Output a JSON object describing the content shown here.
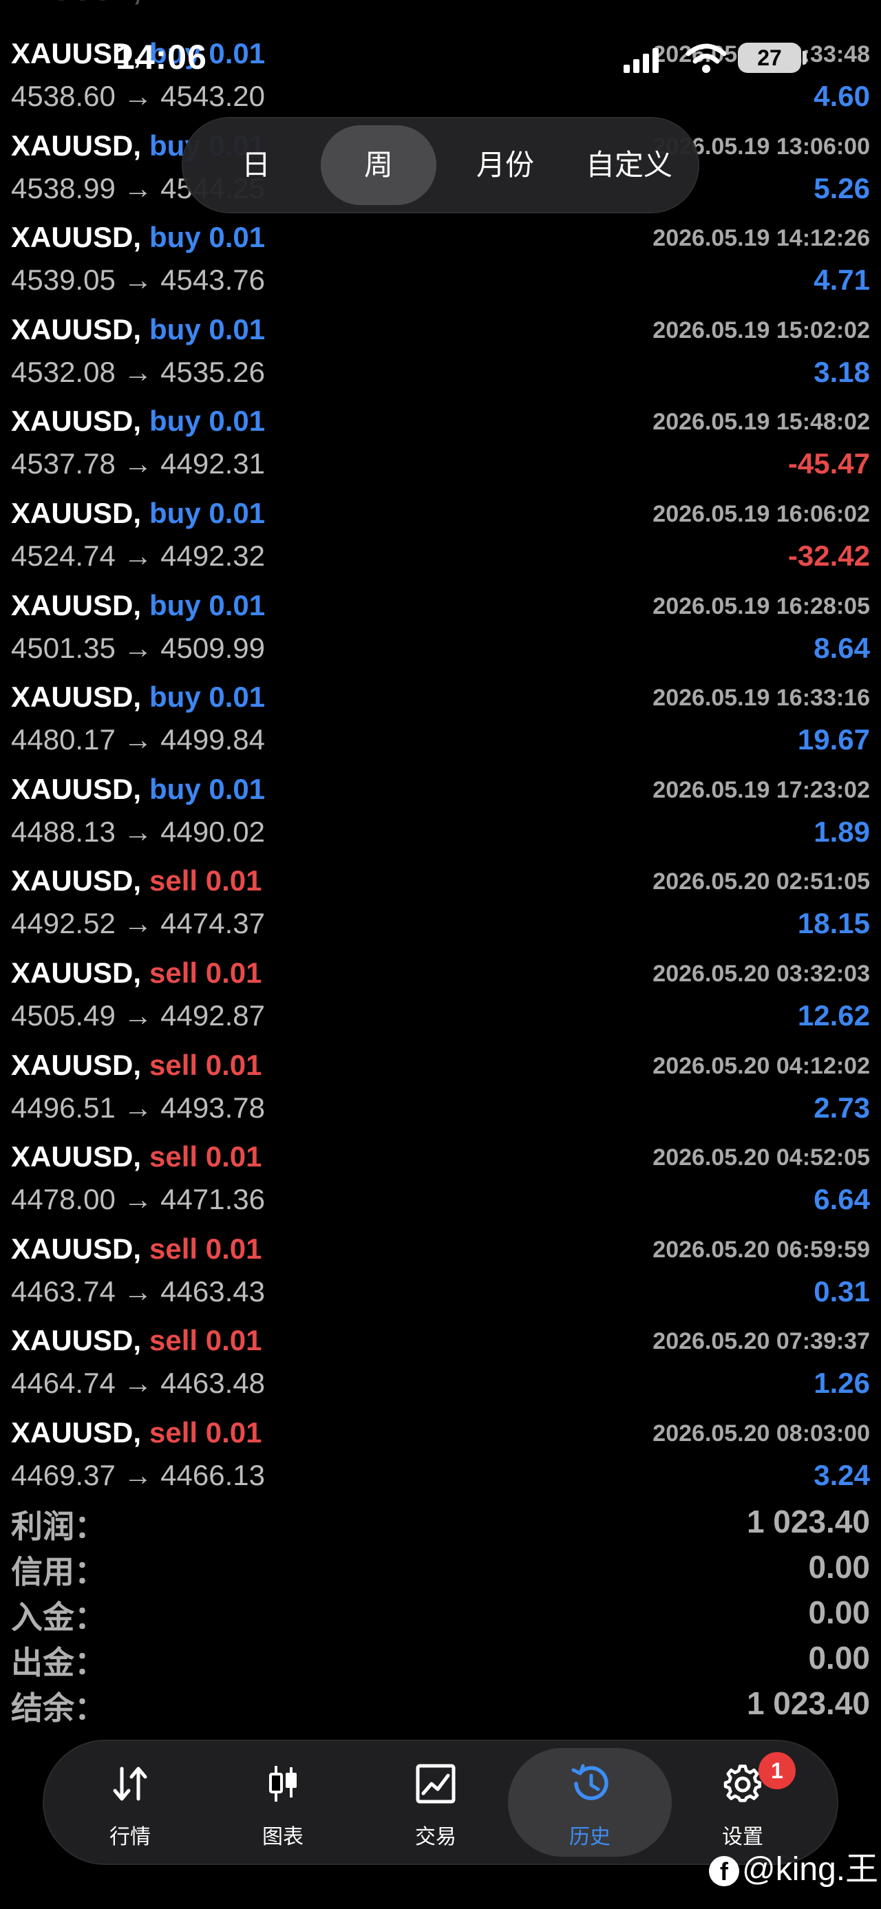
{
  "status_bar": {
    "time": "14:06",
    "battery": "27"
  },
  "period_tabs": [
    {
      "label": "日",
      "active": false
    },
    {
      "label": "周",
      "active": true
    },
    {
      "label": "月份",
      "active": false
    },
    {
      "label": "自定义",
      "active": false
    }
  ],
  "trades": [
    {
      "symbol": "XAUUSD,",
      "side": "buy",
      "lot": "buy 0.01",
      "time": "2026.05.19 12:33:48",
      "prices": "4538.60 → 4543.20",
      "profit": "4.60"
    },
    {
      "symbol": "XAUUSD,",
      "side": "buy",
      "lot": "buy 0.01",
      "time": "2026.05.19 13:06:00",
      "prices": "4538.99 → 4544.25",
      "profit": "5.26"
    },
    {
      "symbol": "XAUUSD,",
      "side": "buy",
      "lot": "buy 0.01",
      "time": "2026.05.19 14:12:26",
      "prices": "4539.05 → 4543.76",
      "profit": "4.71"
    },
    {
      "symbol": "XAUUSD,",
      "side": "buy",
      "lot": "buy 0.01",
      "time": "2026.05.19 15:02:02",
      "prices": "4532.08 → 4535.26",
      "profit": "3.18"
    },
    {
      "symbol": "XAUUSD,",
      "side": "buy",
      "lot": "buy 0.01",
      "time": "2026.05.19 15:48:02",
      "prices": "4537.78 → 4492.31",
      "profit": "-45.47"
    },
    {
      "symbol": "XAUUSD,",
      "side": "buy",
      "lot": "buy 0.01",
      "time": "2026.05.19 16:06:02",
      "prices": "4524.74 → 4492.32",
      "profit": "-32.42"
    },
    {
      "symbol": "XAUUSD,",
      "side": "buy",
      "lot": "buy 0.01",
      "time": "2026.05.19 16:28:05",
      "prices": "4501.35 → 4509.99",
      "profit": "8.64"
    },
    {
      "symbol": "XAUUSD,",
      "side": "buy",
      "lot": "buy 0.01",
      "time": "2026.05.19 16:33:16",
      "prices": "4480.17 → 4499.84",
      "profit": "19.67"
    },
    {
      "symbol": "XAUUSD,",
      "side": "buy",
      "lot": "buy 0.01",
      "time": "2026.05.19 17:23:02",
      "prices": "4488.13 → 4490.02",
      "profit": "1.89"
    },
    {
      "symbol": "XAUUSD,",
      "side": "sell",
      "lot": "sell 0.01",
      "time": "2026.05.20 02:51:05",
      "prices": "4492.52 → 4474.37",
      "profit": "18.15"
    },
    {
      "symbol": "XAUUSD,",
      "side": "sell",
      "lot": "sell 0.01",
      "time": "2026.05.20 03:32:03",
      "prices": "4505.49 → 4492.87",
      "profit": "12.62"
    },
    {
      "symbol": "XAUUSD,",
      "side": "sell",
      "lot": "sell 0.01",
      "time": "2026.05.20 04:12:02",
      "prices": "4496.51 → 4493.78",
      "profit": "2.73"
    },
    {
      "symbol": "XAUUSD,",
      "side": "sell",
      "lot": "sell 0.01",
      "time": "2026.05.20 04:52:05",
      "prices": "4478.00 → 4471.36",
      "profit": "6.64"
    },
    {
      "symbol": "XAUUSD,",
      "side": "sell",
      "lot": "sell 0.01",
      "time": "2026.05.20 06:59:59",
      "prices": "4463.74 → 4463.43",
      "profit": "0.31"
    },
    {
      "symbol": "XAUUSD,",
      "side": "sell",
      "lot": "sell 0.01",
      "time": "2026.05.20 07:39:37",
      "prices": "4464.74 → 4463.48",
      "profit": "1.26"
    },
    {
      "symbol": "XAUUSD,",
      "side": "sell",
      "lot": "sell 0.01",
      "time": "2026.05.20 08:03:00",
      "prices": "4469.37 → 4466.13",
      "profit": "3.24"
    }
  ],
  "summary": [
    {
      "label": "利润：",
      "value": "1 023.40"
    },
    {
      "label": "信用：",
      "value": "0.00"
    },
    {
      "label": "入金：",
      "value": "0.00"
    },
    {
      "label": "出金：",
      "value": "0.00"
    },
    {
      "label": "结余：",
      "value": "1 023.40"
    }
  ],
  "tabbar": [
    {
      "label": "行情",
      "icon": "quotes-arrows-icon",
      "active": false
    },
    {
      "label": "图表",
      "icon": "candlestick-chart-icon",
      "active": false
    },
    {
      "label": "交易",
      "icon": "trade-chart-icon",
      "active": false
    },
    {
      "label": "历史",
      "icon": "history-clock-icon",
      "active": true
    },
    {
      "label": "设置",
      "icon": "gear-icon",
      "active": false
    }
  ],
  "settings_badge": "1",
  "watermark": {
    "text": "@king.王"
  },
  "colors": {
    "buy": "#3d86f2",
    "sell": "#e84a4a",
    "profit_positive": "#3d86f2",
    "profit_negative": "#e84a4a",
    "active_tab": "#3d8ef5"
  }
}
